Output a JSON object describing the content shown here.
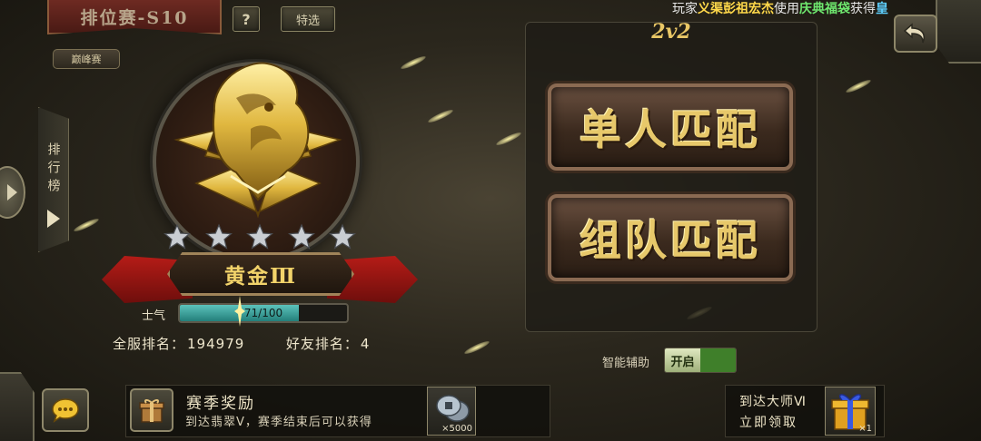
{
  "header": {
    "title": "排位赛-S10",
    "help_label": "?",
    "filter_label": "特选",
    "division_tag": "巅峰赛"
  },
  "marquee": {
    "prefix": "玩家",
    "player": "义渠彭祖宏杰",
    "mid": "使用",
    "item": "庆典福袋",
    "suffix": "获得",
    "tail": "皇"
  },
  "sidebar": {
    "leaderboard_label": "排行榜"
  },
  "rank": {
    "tier": "黄金Ⅲ",
    "stars_earned": 0,
    "stars_total": 5,
    "morale_label": "士气",
    "morale_text": "71/100",
    "morale_fraction": 0.71,
    "server_rank_label": "全服排名：",
    "server_rank_value": "194979",
    "friend_rank_label": "好友排名：",
    "friend_rank_value": "4"
  },
  "match": {
    "mode": "2v2",
    "solo_label": "单人匹配",
    "team_label": "组队匹配",
    "assist_label": "智能辅助",
    "assist_state": "开启"
  },
  "rewards": {
    "title": "赛季奖励",
    "desc": "到达翡翠Ⅴ，赛季结束后可以获得",
    "coin_count": "×5000",
    "master_title": "到达大师Ⅵ",
    "master_claim": "立即领取",
    "present_count": "×1"
  },
  "icons": {
    "emblem": "golden-tiger-emblem-icon",
    "star": "silver-star-icon",
    "back": "back-arrow-icon",
    "chat": "chat-bubble-icon",
    "gift": "gift-box-icon",
    "coin": "copper-coin-icon",
    "present": "present-box-icon",
    "left_arrow": "left-arrow-icon"
  },
  "colors": {
    "gold": "#e9c766",
    "ribbon_red": "#b51c17",
    "morale_fill": "#5cc3bc",
    "assist_green": "#3f7f2a"
  }
}
